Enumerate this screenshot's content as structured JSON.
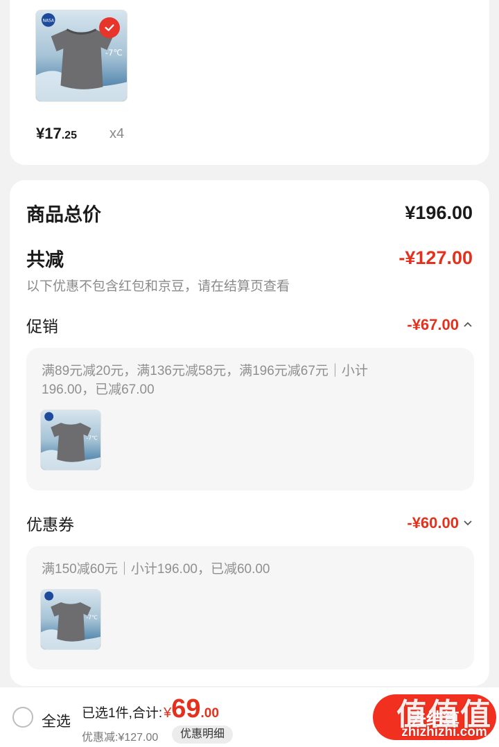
{
  "product": {
    "price_main": "¥17",
    "price_decimal": ".25",
    "quantity": "x4",
    "badge_text": "NASA",
    "temp_text": "-7℃"
  },
  "summary": {
    "total_label": "商品总价",
    "total_value": "¥196.00",
    "reduce_label": "共减",
    "reduce_value": "-¥127.00",
    "note": "以下优惠不包含红包和京豆，请在结算页查看"
  },
  "promotion": {
    "label": "促销",
    "value": "-¥67.00",
    "detail_line1": "满89元减20元，满136元减58元，满196元减67元｜小计",
    "detail_line2": "196.00，已减67.00"
  },
  "coupon": {
    "label": "优惠券",
    "value": "-¥60.00",
    "detail": "满150减60元｜小计196.00，已减60.00"
  },
  "footer": {
    "select_all": "全选",
    "selected_text": "已选1件,合计:",
    "currency": "¥",
    "total_int": "69",
    "total_dec": ".00",
    "discount_text": "优惠减:¥127.00",
    "detail_button": "优惠明细",
    "checkout_button": "去结算"
  },
  "watermark": {
    "text": "值值值",
    "site": "zhizhizhi.com"
  },
  "colors": {
    "accent_red": "#e3311d",
    "checkout_bg": "#f2301f",
    "card_bg": "#ffffff",
    "page_bg": "#f2f2f2"
  },
  "icons": [
    "check-badge-icon",
    "chevron-up-icon",
    "chevron-down-icon",
    "radio-icon"
  ]
}
